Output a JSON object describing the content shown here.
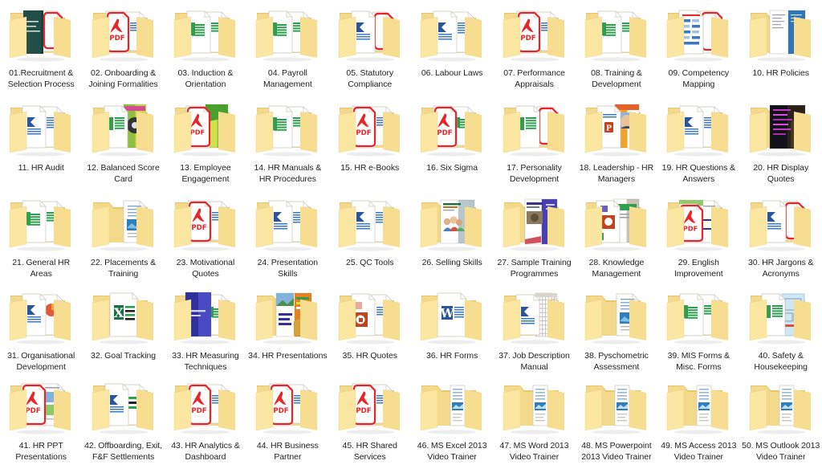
{
  "window": {
    "view": "icon-grid",
    "item_count": 50,
    "columns": 10,
    "rows": 5,
    "background_color": "#ffffff",
    "label_color": "#1f1f1f"
  },
  "palette": {
    "folder_light": "#fbe7a2",
    "folder_mid": "#f7dd8f",
    "folder_dark": "#e8c66a",
    "folder_back": "#f3d98b",
    "paper_white": "#ffffff",
    "paper_edge": "#c9c6bb",
    "pdf_red": "#e8262a",
    "word_blue": "#2a5699",
    "excel_green": "#1d7044",
    "ppt_orange": "#c4431f",
    "accent_blue": "#3b78c3",
    "accent_green": "#2f9e4f"
  },
  "items": [
    {
      "index": 1,
      "label": "01.Recruitment & Selection Process",
      "icon": "folder-with-book-teal"
    },
    {
      "index": 2,
      "label": "02. Onboarding & Joining Formalities",
      "icon": "folder-with-pdf"
    },
    {
      "index": 3,
      "label": "03. Induction & Orientation",
      "icon": "folder-with-excel-doc"
    },
    {
      "index": 4,
      "label": "04. Payroll Management",
      "icon": "folder-with-excel-doc"
    },
    {
      "index": 5,
      "label": "05. Statutory Compliance",
      "icon": "folder-with-word-and-pdf"
    },
    {
      "index": 6,
      "label": "06. Labour Laws",
      "icon": "folder-with-word-doc"
    },
    {
      "index": 7,
      "label": "07. Performance Appraisals",
      "icon": "folder-with-pdf"
    },
    {
      "index": 8,
      "label": "08. Training & Development",
      "icon": "folder-with-excel-doc"
    },
    {
      "index": 9,
      "label": "09. Competency Mapping",
      "icon": "folder-with-slide-and-pdf"
    },
    {
      "index": 10,
      "label": "10. HR Policies",
      "icon": "folder-with-blue-book"
    },
    {
      "index": 11,
      "label": "11. HR Audit",
      "icon": "folder-with-word-doc"
    },
    {
      "index": 12,
      "label": "12. Balanced Score Card",
      "icon": "folder-with-excel-and-book"
    },
    {
      "index": 13,
      "label": "13. Employee Engagement",
      "icon": "folder-with-pdf-and-green-book"
    },
    {
      "index": 14,
      "label": "14. HR Manuals & HR Procedures",
      "icon": "folder-with-excel-doc"
    },
    {
      "index": 15,
      "label": "15. HR e-Books",
      "icon": "folder-with-pdf"
    },
    {
      "index": 16,
      "label": "16. Six Sigma",
      "icon": "folder-with-pdf-and-excel"
    },
    {
      "index": 17,
      "label": "17. Personality Development",
      "icon": "folder-with-excel-and-pdf"
    },
    {
      "index": 18,
      "label": "18. Leadership - HR Managers",
      "icon": "folder-with-portrait-book"
    },
    {
      "index": 19,
      "label": "19. HR Questions & Answers",
      "icon": "folder-with-word-doc"
    },
    {
      "index": 20,
      "label": "20. HR Display Quotes",
      "icon": "folder-with-dark-book"
    },
    {
      "index": 21,
      "label": "21. General HR Areas",
      "icon": "folder-with-excel-doc"
    },
    {
      "index": 22,
      "label": "22. Placements & Training",
      "icon": "folder-with-photo-doc"
    },
    {
      "index": 23,
      "label": "23. Motivational Quotes",
      "icon": "folder-with-pdf"
    },
    {
      "index": 24,
      "label": "24. Presentation Skills",
      "icon": "folder-with-word-doc"
    },
    {
      "index": 25,
      "label": "25. QC Tools",
      "icon": "folder-with-word-doc"
    },
    {
      "index": 26,
      "label": "26. Selling Skills",
      "icon": "folder-with-people-book"
    },
    {
      "index": 27,
      "label": "27. Sample Training Programmes",
      "icon": "folder-with-purple-book"
    },
    {
      "index": 28,
      "label": "28. Knowledge Management",
      "icon": "folder-with-green-book-ppt"
    },
    {
      "index": 29,
      "label": "29. English Improvement",
      "icon": "folder-with-pdf-and-book"
    },
    {
      "index": 30,
      "label": "30. HR Jargons & Acronyms",
      "icon": "folder-with-word-and-pdf"
    },
    {
      "index": 31,
      "label": "31. Organisational Development",
      "icon": "folder-with-word-and-ppt"
    },
    {
      "index": 32,
      "label": "32. Goal Tracking",
      "icon": "folder-with-excel-file"
    },
    {
      "index": 33,
      "label": "33. HR Measuring Techniques",
      "icon": "folder-with-blue-book-excel"
    },
    {
      "index": 34,
      "label": "34. HR Presentations",
      "icon": "folder-with-orange-book"
    },
    {
      "index": 35,
      "label": "35. HR Quotes",
      "icon": "folder-with-ppt-doc"
    },
    {
      "index": 36,
      "label": "36. HR Forms",
      "icon": "folder-with-word-file"
    },
    {
      "index": 37,
      "label": "37. Job Description Manual",
      "icon": "folder-with-word-and-grid"
    },
    {
      "index": 38,
      "label": "38. Pyschometric Assessment",
      "icon": "folder-with-photo-doc"
    },
    {
      "index": 39,
      "label": "39. MIS Forms & Misc. Forms",
      "icon": "folder-with-excel-doc"
    },
    {
      "index": 40,
      "label": "40. Safety & Housekeeping",
      "icon": "folder-with-excel-and-plan"
    },
    {
      "index": 41,
      "label": "41. HR PPT Presentations",
      "icon": "folder-with-pdf-and-chart"
    },
    {
      "index": 42,
      "label": "42. Offboarding, Exit, F&F Settlements",
      "icon": "folder-with-word-and-excel"
    },
    {
      "index": 43,
      "label": "43. HR Analytics & Dashboard",
      "icon": "folder-with-pdf"
    },
    {
      "index": 44,
      "label": "44. HR Business Partner",
      "icon": "folder-with-pdf"
    },
    {
      "index": 45,
      "label": "45. HR Shared Services",
      "icon": "folder-with-pdf"
    },
    {
      "index": 46,
      "label": "46. MS Excel 2013 Video Trainer",
      "icon": "folder-with-video-sheet"
    },
    {
      "index": 47,
      "label": "47. MS Word 2013 Video Trainer",
      "icon": "folder-with-video-sheet"
    },
    {
      "index": 48,
      "label": "48. MS Powerpoint 2013 Video Trainer",
      "icon": "folder-with-video-sheet"
    },
    {
      "index": 49,
      "label": "49. MS Access 2013 Video Trainer",
      "icon": "folder-with-video-sheet"
    },
    {
      "index": 50,
      "label": "50. MS Outlook 2013 Video Trainer",
      "icon": "folder-with-video-sheet"
    }
  ]
}
